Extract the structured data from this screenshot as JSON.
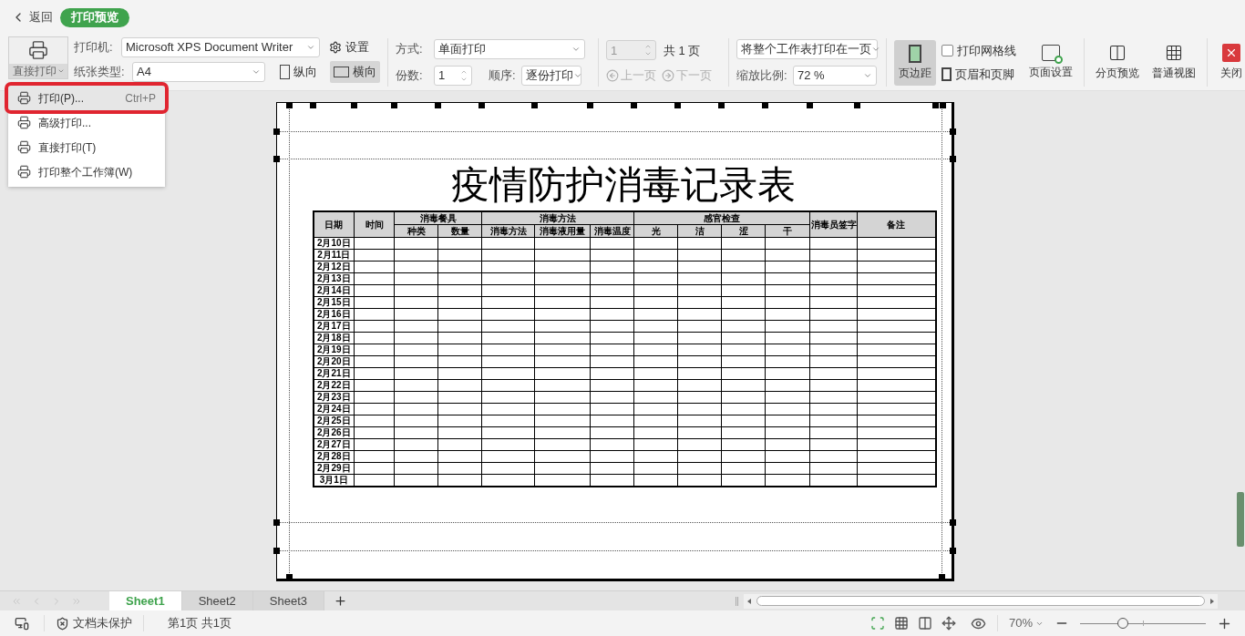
{
  "header": {
    "back": "返回",
    "mode": "打印预览"
  },
  "toolbar": {
    "print_button": "直接打印",
    "printer_label": "打印机:",
    "printer": "Microsoft XPS Document Writer",
    "settings": "设置",
    "paper_label": "纸张类型:",
    "paper": "A4",
    "orientations": [
      {
        "label": "纵向",
        "selected": false
      },
      {
        "label": "横向",
        "selected": true
      }
    ],
    "mode_label": "方式:",
    "mode": "单面打印",
    "copies_label": "份数:",
    "copies": "1",
    "order_label": "顺序:",
    "order": "逐份打印",
    "page_field": "1",
    "total_pages": "共 1 页",
    "prev": {
      "label": "上一页",
      "disabled": true
    },
    "next": {
      "label": "下一页",
      "disabled": true
    },
    "fit": "将整个工作表打印在一页",
    "zoom_label": "缩放比例:",
    "zoom": "72 %",
    "margins": {
      "label": "页边距",
      "selected": true
    },
    "gridlines": {
      "label": "打印网格线",
      "checked": false
    },
    "header_footer": "页眉和页脚",
    "page_setup": "页面设置",
    "page_break_preview": "分页预览",
    "normal_view": "普通视图",
    "close": "关闭"
  },
  "print_menu": [
    {
      "label": "打印(P)...",
      "shortcut": "Ctrl+P",
      "highlighted": true
    },
    {
      "label": "高级打印...",
      "highlighted": false
    },
    {
      "label": "直接打印(T)",
      "highlighted": false
    },
    {
      "label": "打印整个工作簿(W)",
      "highlighted": false
    }
  ],
  "sheet": {
    "title": "疫情防护消毒记录表",
    "columns": [
      {
        "label": "日期"
      },
      {
        "label": "时间"
      },
      {
        "label": "消毒餐具",
        "children": [
          "种类",
          "数量"
        ]
      },
      {
        "label": "消毒方法",
        "children": [
          "消毒方法",
          "消毒液用量",
          "消毒温度"
        ]
      },
      {
        "label": "感官检查",
        "children": [
          "光",
          "洁",
          "涩",
          "干"
        ]
      },
      {
        "label": "消毒员签字"
      },
      {
        "label": "备注"
      }
    ],
    "dates": [
      "2月10日",
      "2月11日",
      "2月12日",
      "2月13日",
      "2月14日",
      "2月15日",
      "2月16日",
      "2月17日",
      "2月18日",
      "2月19日",
      "2月20日",
      "2月21日",
      "2月22日",
      "2月23日",
      "2月24日",
      "2月25日",
      "2月26日",
      "2月27日",
      "2月28日",
      "2月29日",
      "3月1日"
    ]
  },
  "sheet_tabs": [
    {
      "label": "Sheet1",
      "selected": true
    },
    {
      "label": "Sheet2",
      "selected": false
    },
    {
      "label": "Sheet3",
      "selected": false
    }
  ],
  "status_bar": {
    "protection": "文档未保护",
    "page_info": "第1页 共1页",
    "zoom": "70%",
    "zoom_slider": {
      "level": 0.34
    }
  }
}
